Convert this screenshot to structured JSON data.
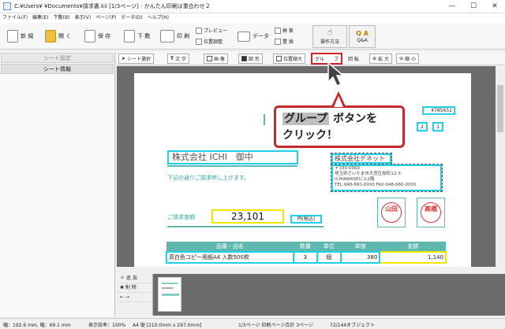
{
  "window": {
    "title": "C:¥Users¥  ¥Documents¥請求書.kii [1/3ページ] - かんたん印刷は重合わせ２",
    "minimize": "—",
    "maximize": "☐",
    "close": "✕"
  },
  "menu": [
    "ファイル(F)",
    "編集(E)",
    "下敷(B)",
    "表示(V)",
    "ページ(P)",
    "データ(D)",
    "ヘルプ(H)"
  ],
  "toolbar": {
    "new": "新 規",
    "open": "開 く",
    "save": "保 存",
    "underlay": "下 敷",
    "print": "印 刷",
    "preview": "プレビュー",
    "position_adjust": "位置調整",
    "data": "データ",
    "search": "検 索",
    "replace": "置 換",
    "howto": "操作方法",
    "qa": "Q&A"
  },
  "sidebar": {
    "items": [
      "シート設定",
      "シート情報"
    ]
  },
  "subtoolbar": {
    "select": "シート選択",
    "text": "文 字",
    "image": "画 像",
    "shape": "図 形",
    "position_shrink": "位置縮大",
    "group": "グル",
    "group_tail": "プ",
    "rotate": "回 転",
    "zoom_in": "拡 大",
    "zoom_out": "縮 小"
  },
  "callout": {
    "hl_text": "グループ",
    "line1_rest": " ボタンを",
    "line2": "クリック！"
  },
  "invoice": {
    "customer": "株式会社 ICHI　御中",
    "note": "下記の通りご請求申し上げます。",
    "amount_label": "ご請求金額",
    "amount": "23,101",
    "tax_label": "円(税込)",
    "doc_number": "4785651",
    "page_mark_a": "2",
    "page_mark_b": "1",
    "company": "株式会社デネット",
    "postal": "〒330-0000",
    "address1": "埼玉県さいたま市大宮区桜町12-3",
    "address2": "ICHIAWASEビル2階",
    "phone": "TEL:048-660-0000  FAX:048-660-0000",
    "stamp1": "山田",
    "stamp2": "高橋",
    "table_headers": [
      "品番・品名",
      "数量",
      "単位",
      "単価",
      "金額"
    ],
    "row1": [
      "高白色コピー用紙A4 入数500枚",
      "3",
      "個",
      "380",
      "1,140"
    ]
  },
  "bottom": {
    "add": "追 加",
    "delete": "削 除",
    "arrows": "← →"
  },
  "status": {
    "size": "幅：192.6 mm, 幅：69.1 mm",
    "zoom": "表示倍率：100%",
    "paper": "A4 縦 [210.0mm x 297.0mm]",
    "pages": "1/3ページ 印刷ページ合計 3ページ",
    "objects": "72/144オブジェクト"
  },
  "colors": {
    "accent_red": "#c8282d",
    "cyan": "#22d0e6",
    "yellow": "#f0e800",
    "teal_header": "#5fb8b0"
  }
}
